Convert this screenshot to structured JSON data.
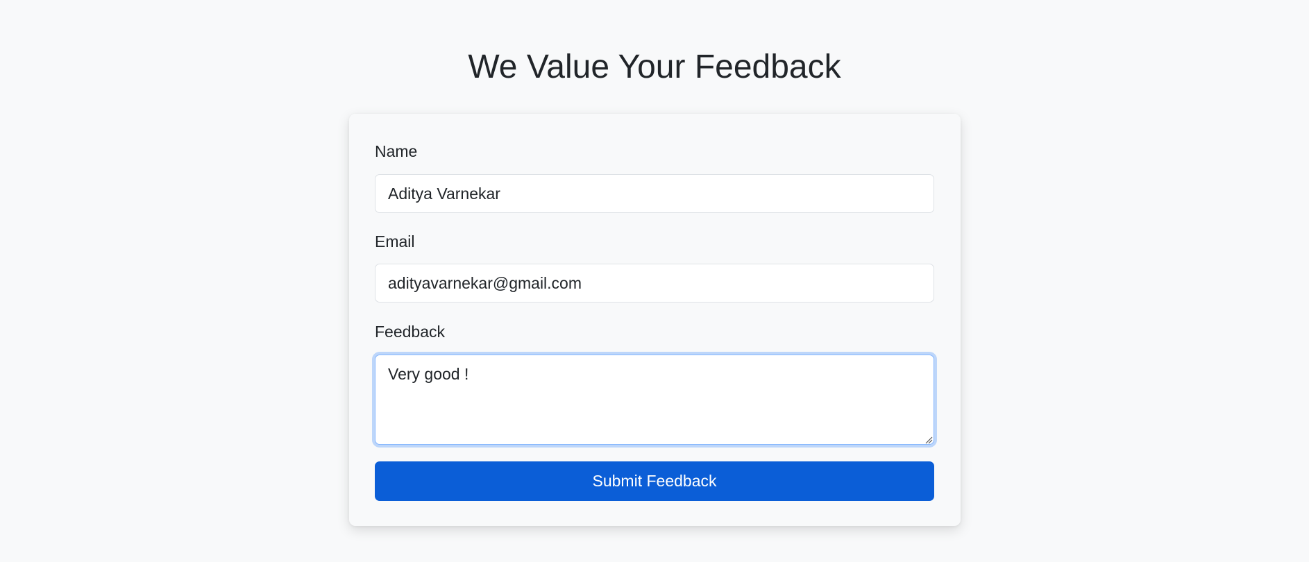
{
  "page": {
    "title": "We Value Your Feedback"
  },
  "form": {
    "name_label": "Name",
    "name_value": "Aditya Varnekar",
    "email_label": "Email",
    "email_value": "adityavarnekar@gmail.com",
    "feedback_label": "Feedback",
    "feedback_value": "Very good !",
    "submit_label": "Submit Feedback"
  },
  "colors": {
    "background": "#f8f9fa",
    "primary_button": "#0b5ed7",
    "focus_ring": "#86b7fe",
    "text": "#212529"
  },
  "icons": {
    "textarea_resize": "resize-grip-icon"
  }
}
